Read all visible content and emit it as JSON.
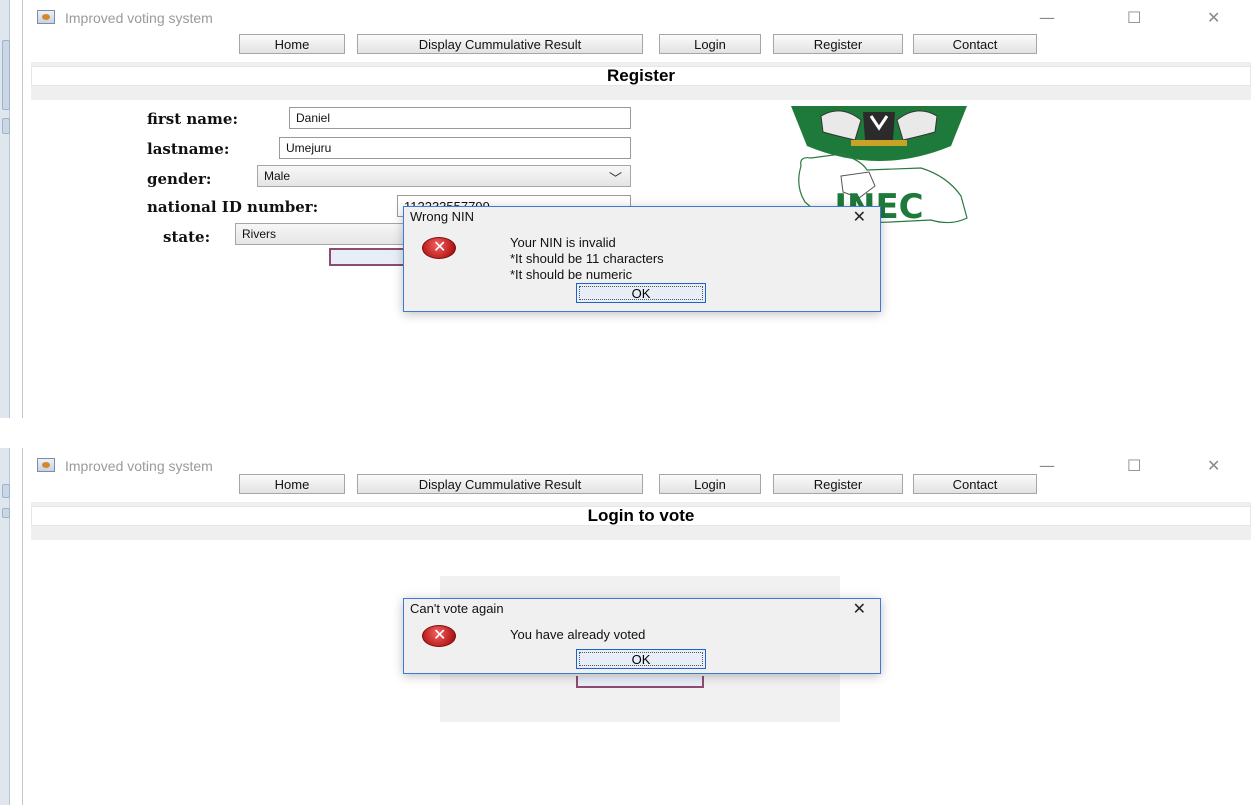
{
  "app_title": "Improved voting system",
  "window_controls": {
    "minimize": "—",
    "maximize": "☐",
    "close": "✕"
  },
  "menu": [
    "Home",
    "Display Cummulative Result",
    "Login",
    "Register",
    "Contact"
  ],
  "register_screen": {
    "heading": "Register",
    "fields": {
      "first_name_label": "first name:",
      "first_name_value": "Daniel",
      "lastname_label": "lastname:",
      "lastname_value": "Umejuru",
      "gender_label": "gender:",
      "gender_value": "Male",
      "nin_label": "national ID number:",
      "nin_value": "112233557799",
      "state_label": "state:",
      "state_value": "Rivers"
    },
    "emblem_text": "INEC",
    "dialog": {
      "title": "Wrong NIN",
      "close": "✕",
      "lines": [
        "Your NIN is invalid",
        "*It should be 11 characters",
        "*It should be numeric"
      ],
      "ok": "OK"
    }
  },
  "login_screen": {
    "heading": "Login to vote",
    "dialog": {
      "title": "Can't vote again",
      "close": "✕",
      "message": "You have already voted",
      "ok": "OK"
    }
  },
  "icons": {
    "error": "error-icon",
    "dropdown": "chevron-down-icon",
    "app": "java-app-icon"
  },
  "colors": {
    "dialog_border": "#3d7ad6",
    "error_red": "#b81a1a",
    "emblem_green": "#1e7a3a"
  }
}
